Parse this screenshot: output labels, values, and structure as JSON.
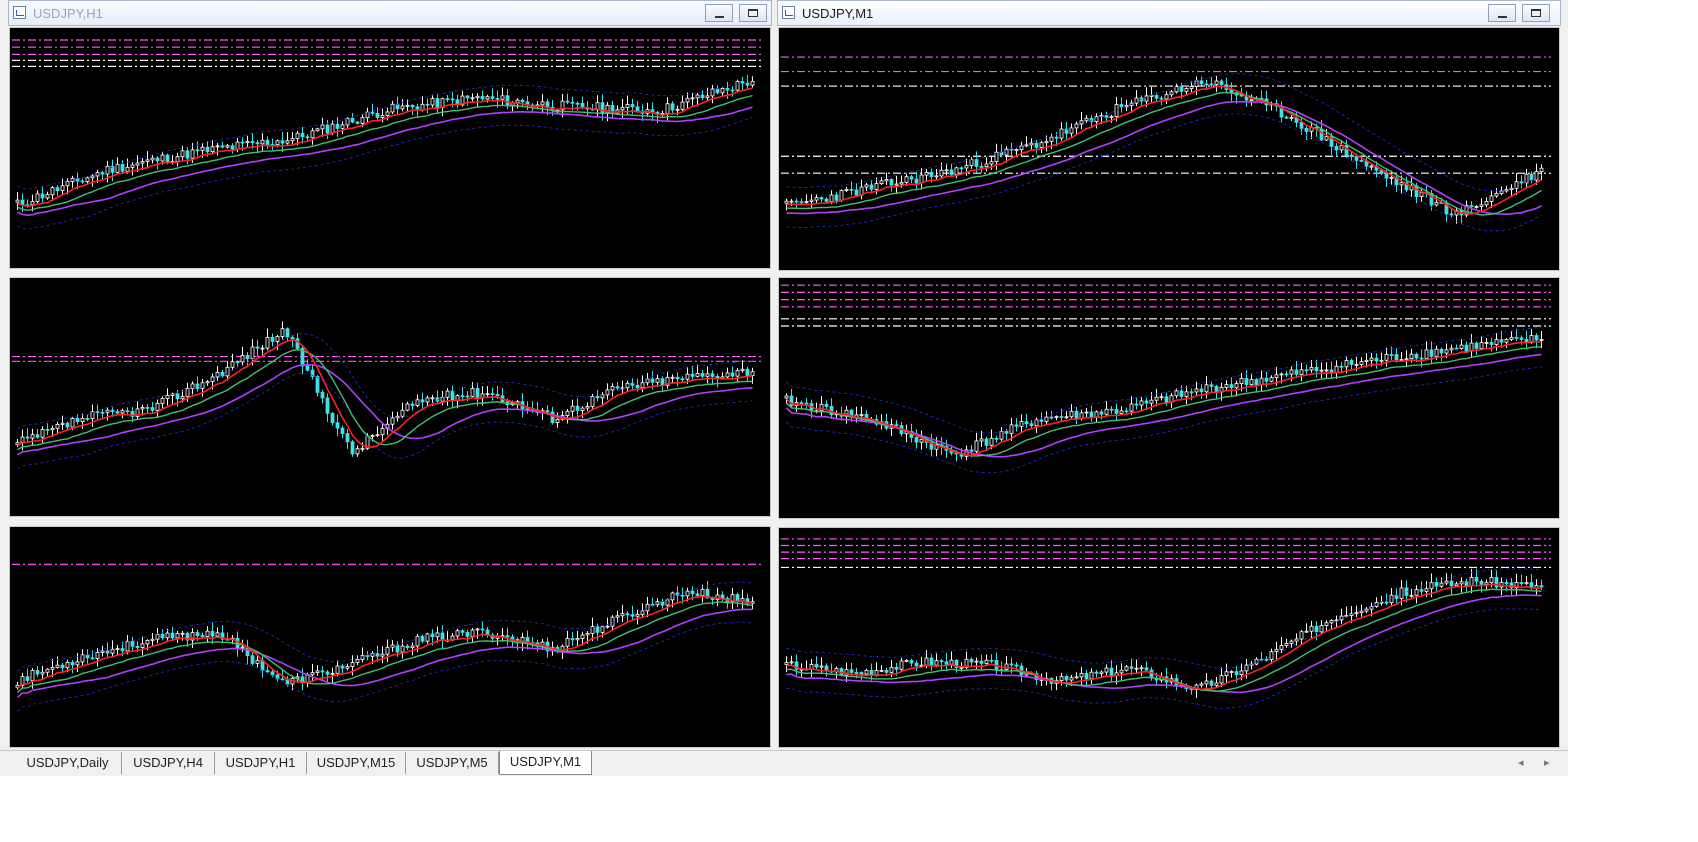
{
  "windows": [
    {
      "id": "w1",
      "title": "USDJPY,H1",
      "active": false,
      "seed": 11,
      "trend": [
        0.25,
        0.45,
        0.55,
        0.62,
        0.78,
        0.85,
        0.8,
        0.78,
        0.95
      ],
      "levels": [
        {
          "y": 0.05,
          "c": "#ff55ff"
        },
        {
          "y": 0.08,
          "c": "#ff55ff"
        },
        {
          "y": 0.11,
          "c": "#ff55ff"
        },
        {
          "y": 0.135,
          "c": "#ffffff"
        },
        {
          "y": 0.16,
          "c": "#ffffff"
        }
      ]
    },
    {
      "id": "w2",
      "title": "USDJPY,M1",
      "active": true,
      "seed": 23,
      "trend": [
        0.25,
        0.35,
        0.45,
        0.6,
        0.8,
        0.95,
        0.75,
        0.45,
        0.2,
        0.45
      ],
      "levels": [
        {
          "y": 0.12,
          "c": "#ff55ff"
        },
        {
          "y": 0.18,
          "c": "#ff55ff"
        },
        {
          "y": 0.24,
          "c": "#ffffff"
        },
        {
          "y": 0.53,
          "c": "#ffffff"
        },
        {
          "y": 0.6,
          "c": "#ffffff"
        }
      ]
    },
    {
      "id": "w3",
      "title": "",
      "active": false,
      "seed": 37,
      "trend": [
        0.3,
        0.45,
        0.5,
        0.7,
        0.95,
        0.25,
        0.55,
        0.6,
        0.45,
        0.62,
        0.68,
        0.72
      ],
      "levels": [
        {
          "y": 0.33,
          "c": "#ff55ff"
        },
        {
          "y": 0.35,
          "c": "#ff55ff"
        }
      ]
    },
    {
      "id": "w4",
      "title": "",
      "active": false,
      "seed": 41,
      "trend": [
        0.55,
        0.45,
        0.25,
        0.45,
        0.5,
        0.62,
        0.7,
        0.78,
        0.85,
        0.9
      ],
      "levels": [
        {
          "y": 0.03,
          "c": "#ff55ff"
        },
        {
          "y": 0.06,
          "c": "#ff55ff"
        },
        {
          "y": 0.09,
          "c": "#ff55ff"
        },
        {
          "y": 0.12,
          "c": "#ff55ff"
        },
        {
          "y": 0.17,
          "c": "#ffffff"
        },
        {
          "y": 0.2,
          "c": "#ffffff"
        }
      ]
    },
    {
      "id": "w5",
      "title": "",
      "active": false,
      "seed": 53,
      "trend": [
        0.3,
        0.45,
        0.55,
        0.6,
        0.28,
        0.4,
        0.55,
        0.6,
        0.5,
        0.68,
        0.85,
        0.78
      ],
      "levels": [
        {
          "y": 0.17,
          "c": "#ff55ff"
        }
      ]
    },
    {
      "id": "w6",
      "title": "",
      "active": false,
      "seed": 67,
      "trend": [
        0.4,
        0.35,
        0.42,
        0.4,
        0.3,
        0.38,
        0.25,
        0.45,
        0.7,
        0.85,
        0.92,
        0.88
      ],
      "levels": [
        {
          "y": 0.05,
          "c": "#ff55ff"
        },
        {
          "y": 0.08,
          "c": "#ff55ff"
        },
        {
          "y": 0.11,
          "c": "#ff55ff"
        },
        {
          "y": 0.14,
          "c": "#ff55ff"
        },
        {
          "y": 0.18,
          "c": "#ffffff"
        }
      ]
    }
  ],
  "tabs": [
    {
      "label": "USDJPY,Daily",
      "active": false
    },
    {
      "label": "USDJPY,H4",
      "active": false
    },
    {
      "label": "USDJPY,H1",
      "active": false
    },
    {
      "label": "USDJPY,M15",
      "active": false
    },
    {
      "label": "USDJPY,M5",
      "active": false
    },
    {
      "label": "USDJPY,M1",
      "active": true
    }
  ],
  "colors": {
    "background": "#000000",
    "candle_up": "#ffffff",
    "candle_down": "#40e0e8",
    "ma_fast": "#ff2020",
    "ma_mid": "#40c070",
    "ma_slow": "#b040ff",
    "envelope": "#2030d0"
  },
  "icons": {
    "window_icon": "chart-window-icon",
    "minimize": "minimize-icon",
    "maximize": "maximize-icon",
    "scroll_left": "scroll-left-icon",
    "scroll_right": "scroll-right-icon"
  }
}
